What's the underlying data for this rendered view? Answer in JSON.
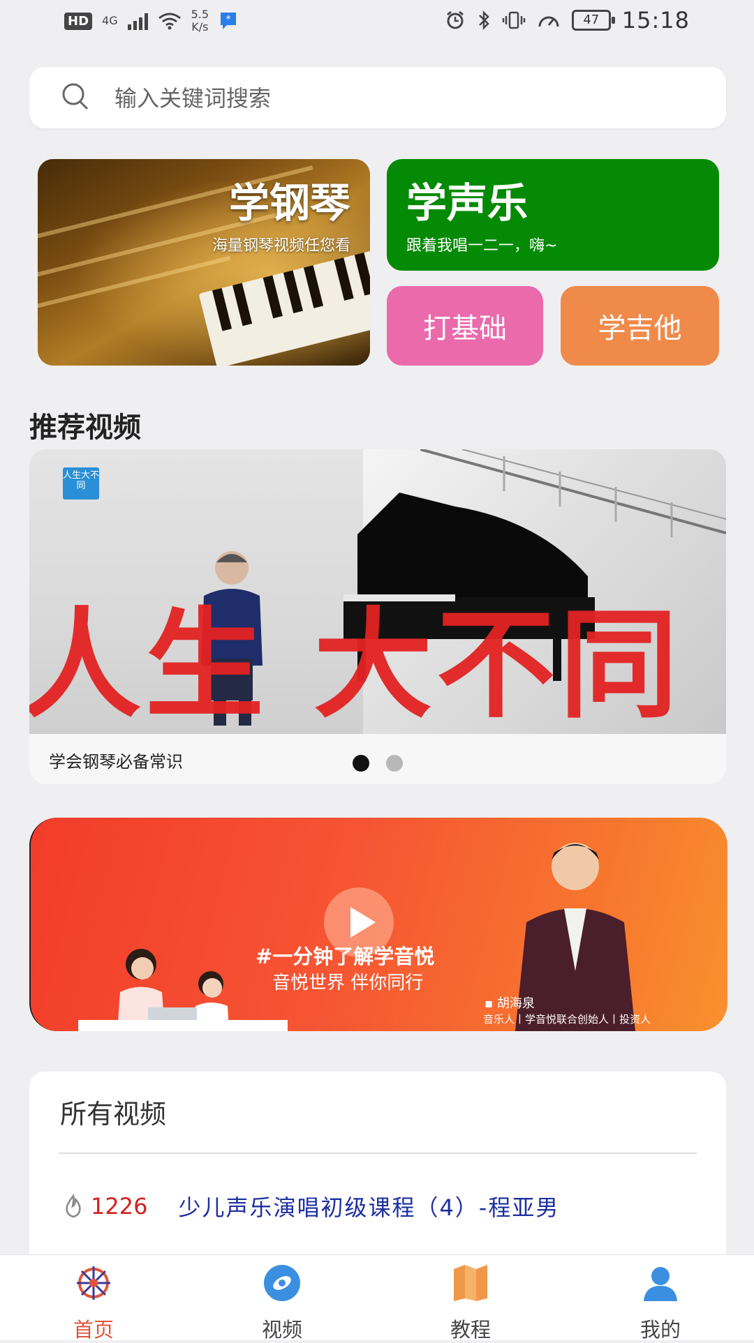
{
  "status_bar": {
    "hd": "HD",
    "network": "4G",
    "speed_value": "5.5",
    "speed_unit": "K/s",
    "battery": "47",
    "time": "15:18"
  },
  "search": {
    "placeholder": "输入关键词搜索"
  },
  "categories": {
    "piano": {
      "title": "学钢琴",
      "subtitle": "海量钢琴视频任您看"
    },
    "vocal": {
      "title": "学声乐",
      "subtitle": "跟着我唱一二一，嗨~"
    },
    "basics": {
      "title": "打基础"
    },
    "guitar": {
      "title": "学吉他"
    }
  },
  "recommended": {
    "section_title": "推荐视频",
    "logo_text": "人生大不同",
    "overlay_text": "人生 大不同",
    "caption": "学会钢琴必备常识",
    "active_slide": 1,
    "slide_count": 2
  },
  "promo": {
    "headline": "#一分钟了解学音悦",
    "tagline": "音悦世界 伴你同行",
    "person_name": "▪ 胡海泉",
    "person_role": "音乐人丨学音悦联合创始人丨投资人"
  },
  "all_videos": {
    "title": "所有视频",
    "items": [
      {
        "views": "1226",
        "name": "少儿声乐演唱初级课程（4）-程亚男"
      }
    ]
  },
  "tabs": [
    {
      "label": "首页",
      "icon": "home-icon",
      "active": true
    },
    {
      "label": "视频",
      "icon": "video-icon",
      "active": false
    },
    {
      "label": "教程",
      "icon": "book-icon",
      "active": false
    },
    {
      "label": "我的",
      "icon": "profile-icon",
      "active": false
    }
  ],
  "colors": {
    "vocal_card": "#058a05",
    "basics_card": "#ea6aab",
    "guitar_card": "#f08a4a",
    "active_tab": "#e0553a",
    "view_count": "#d42020",
    "video_title": "#1d2fa0"
  }
}
